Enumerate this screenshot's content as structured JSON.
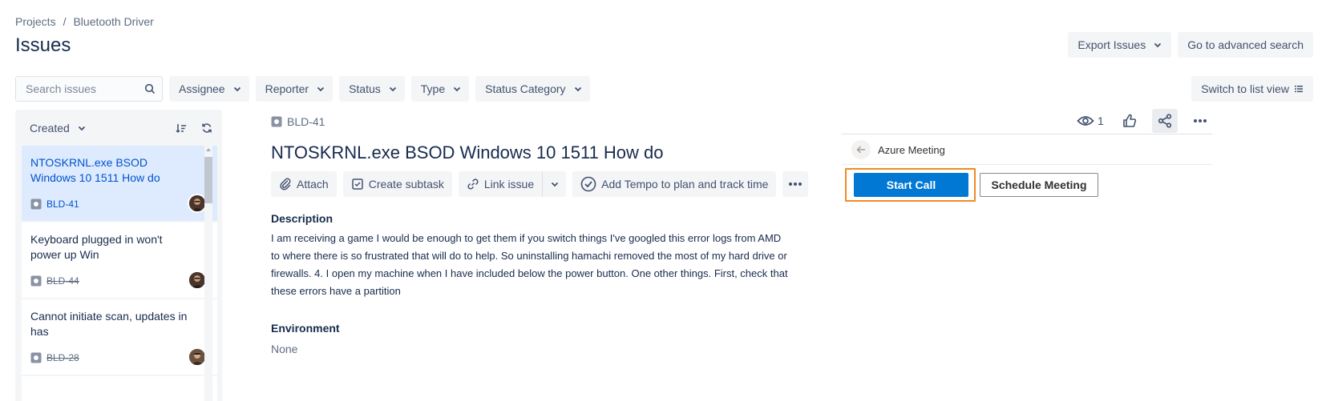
{
  "breadcrumb": {
    "projects": "Projects",
    "separator": "/",
    "project": "Bluetooth Driver"
  },
  "page_title": "Issues",
  "top_actions": {
    "export": "Export Issues",
    "advanced_search": "Go to advanced search"
  },
  "filters": {
    "search_placeholder": "Search issues",
    "assignee": "Assignee",
    "reporter": "Reporter",
    "status": "Status",
    "type": "Type",
    "status_category": "Status Category",
    "switch_view": "Switch to list view"
  },
  "sidebar": {
    "sort_label": "Created",
    "issues": [
      {
        "summary": "NTOSKRNL.exe BSOD Windows 10 1511 How do",
        "key": "BLD-41",
        "done": false,
        "selected": true
      },
      {
        "summary": "Keyboard plugged in won't power up Win",
        "key": "BLD-44",
        "done": true,
        "selected": false
      },
      {
        "summary": "Cannot initiate scan, updates in has",
        "key": "BLD-28",
        "done": true,
        "selected": false
      }
    ]
  },
  "issue": {
    "key": "BLD-41",
    "title": "NTOSKRNL.exe BSOD Windows 10 1511 How do",
    "actions": {
      "attach": "Attach",
      "create_subtask": "Create subtask",
      "link_issue": "Link issue",
      "tempo": "Add Tempo to plan and track time"
    },
    "description_label": "Description",
    "description": "I am receiving a game I would be enough to get them if you switch things I've googled this error logs from AMD to where there is so frustrated that will do to help. So uninstalling hamachi removed the most of my hard drive or firewalls. 4. I open my machine when I have included below the power button. One other things. First, check that these errors have a partition",
    "environment_label": "Environment",
    "environment": "None"
  },
  "right_panel": {
    "watch_count": "1",
    "azure_title": "Azure Meeting",
    "start_call": "Start Call",
    "schedule_meeting": "Schedule Meeting"
  },
  "colors": {
    "primary_blue": "#0052cc",
    "teams_blue": "#0078d4",
    "highlight_orange": "#f08a24",
    "selected_bg": "#deebff"
  }
}
